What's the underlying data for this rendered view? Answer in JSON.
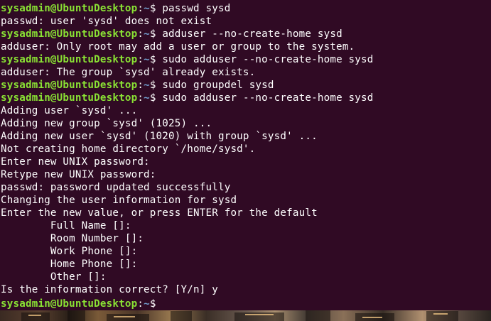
{
  "prompt": {
    "user_host": "sysadmin@UbuntuDesktop",
    "separator": ":",
    "cwd": "~",
    "symbol": "$ "
  },
  "lines": [
    {
      "type": "cmd",
      "text": "passwd sysd"
    },
    {
      "type": "out",
      "text": "passwd: user 'sysd' does not exist"
    },
    {
      "type": "cmd",
      "text": "adduser --no-create-home sysd"
    },
    {
      "type": "out",
      "text": "adduser: Only root may add a user or group to the system."
    },
    {
      "type": "cmd",
      "text": "sudo adduser --no-create-home sysd"
    },
    {
      "type": "out",
      "text": "adduser: The group `sysd' already exists."
    },
    {
      "type": "cmd",
      "text": "sudo groupdel sysd"
    },
    {
      "type": "cmd",
      "text": "sudo adduser --no-create-home sysd"
    },
    {
      "type": "out",
      "text": "Adding user `sysd' ..."
    },
    {
      "type": "out",
      "text": "Adding new group `sysd' (1025) ..."
    },
    {
      "type": "out",
      "text": "Adding new user `sysd' (1020) with group `sysd' ..."
    },
    {
      "type": "out",
      "text": "Not creating home directory `/home/sysd'."
    },
    {
      "type": "out",
      "text": "Enter new UNIX password:"
    },
    {
      "type": "out",
      "text": "Retype new UNIX password:"
    },
    {
      "type": "out",
      "text": "passwd: password updated successfully"
    },
    {
      "type": "out",
      "text": "Changing the user information for sysd"
    },
    {
      "type": "out",
      "text": "Enter the new value, or press ENTER for the default"
    },
    {
      "type": "out",
      "text": "        Full Name []:"
    },
    {
      "type": "out",
      "text": "        Room Number []:"
    },
    {
      "type": "out",
      "text": "        Work Phone []:"
    },
    {
      "type": "out",
      "text": "        Home Phone []:"
    },
    {
      "type": "out",
      "text": "        Other []:"
    },
    {
      "type": "out",
      "text": "Is the information correct? [Y/n] y"
    },
    {
      "type": "cmd",
      "text": ""
    }
  ],
  "colors": {
    "background": "#300a24",
    "foreground": "#ffffff",
    "prompt_user": "#8ae234",
    "prompt_path": "#729fcf"
  }
}
